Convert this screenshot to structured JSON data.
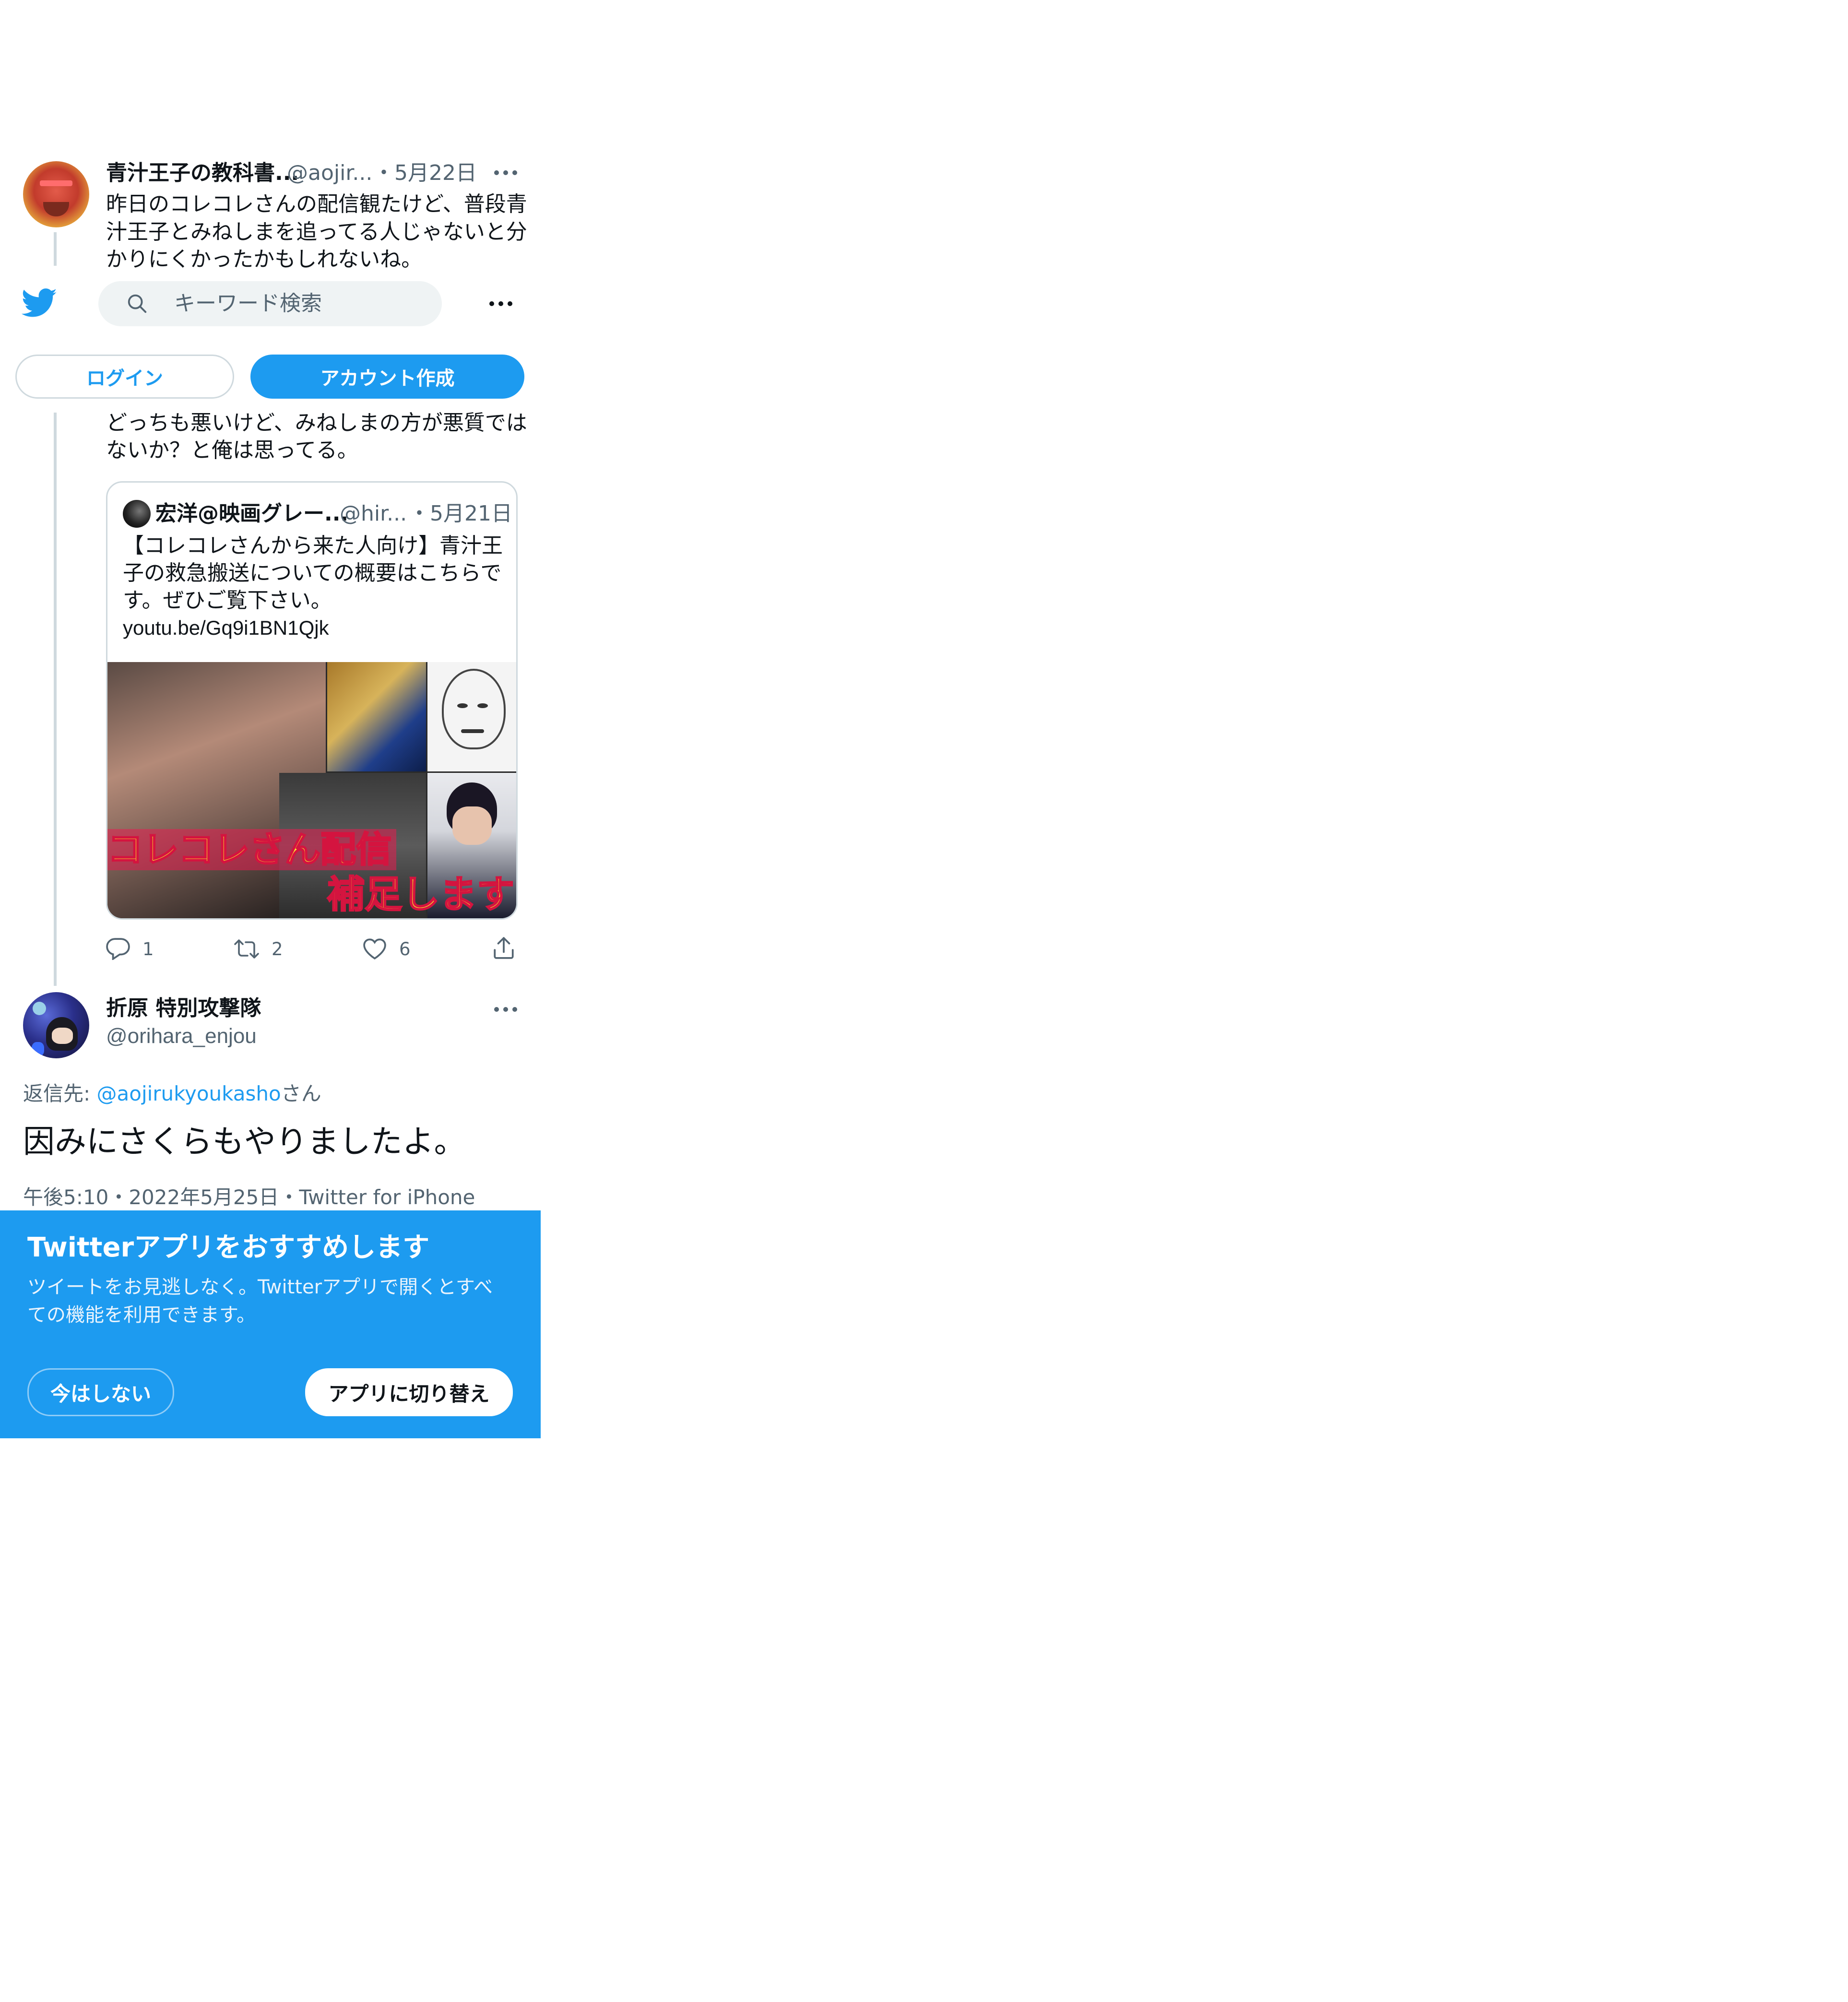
{
  "header": {
    "search_placeholder": "キーワード検索",
    "login_label": "ログイン",
    "signup_label": "アカウント作成"
  },
  "parent_tweet": {
    "display_name": "青汁王子の教科書...",
    "handle": "@aojir...",
    "date": "・5月22日",
    "text_top_1": "昨日のコレコレさんの配信観たけど、普段青",
    "text_top_2": "汁王子とみねしまを追ってる人じゃないと分",
    "text_top_3": "かりにくかったかもしれないね。",
    "text_bottom_1": "どっちも悪いけど、みねしまの方が悪質では",
    "text_bottom_2": "ないか？と俺は思ってる。",
    "reply_count": "1",
    "retweet_count": "2",
    "like_count": "6"
  },
  "quote": {
    "display_name": "宏洋@映画グレー...",
    "handle": "@hir...",
    "date": "・5月21日",
    "text_1": "【コレコレさんから来た人向け】青汁王",
    "text_2": "子の救急搬送についての概要はこちらで",
    "text_3": "す。ぜひご覧下さい。",
    "link": "youtu.be/Gq9i1BN1Qjk",
    "thumb_caption_1": "コレコレさん配信",
    "thumb_caption_2": "補足します"
  },
  "main_tweet": {
    "display_name": "折原 特別攻撃隊",
    "handle": "@orihara_enjou",
    "reply_prefix": "返信先: ",
    "reply_to": "@aojirukyoukasho",
    "reply_suffix": "さん",
    "text": "因みにさくらもやりましたよ。",
    "meta": "午後5:10・2022年5月25日・Twitter for iPhone"
  },
  "app_banner": {
    "title": "Twitterアプリをおすすめします",
    "body_1": "ツイートをお見逃しなく。Twitterアプリで開くとすべ",
    "body_2": "ての機能を利用できます。",
    "dismiss_label": "今はしない",
    "switch_label": "アプリに切り替え"
  },
  "colors": {
    "accent": "#1d9bf0",
    "text": "#0f1419",
    "secondary": "#536471",
    "border": "#cfd9de"
  },
  "icons": [
    "twitter-bird-icon",
    "search-icon",
    "more-icon",
    "reply-icon",
    "retweet-icon",
    "like-icon",
    "share-icon"
  ]
}
